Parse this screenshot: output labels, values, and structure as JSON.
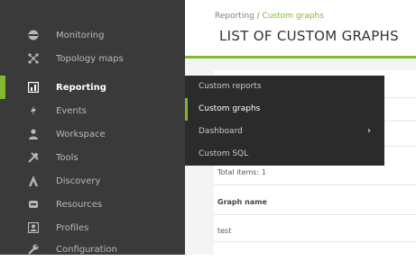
{
  "sidebar": {
    "items": [
      {
        "label": "Monitoring"
      },
      {
        "label": "Topology maps"
      },
      {
        "label": "Reporting"
      },
      {
        "label": "Events"
      },
      {
        "label": "Workspace"
      },
      {
        "label": "Tools"
      },
      {
        "label": "Discovery"
      },
      {
        "label": "Resources"
      },
      {
        "label": "Profiles"
      },
      {
        "label": "Configuration"
      }
    ]
  },
  "header": {
    "breadcrumb_parent": "Reporting",
    "breadcrumb_sep": " / ",
    "breadcrumb_current": "Custom graphs",
    "title": "LIST OF CUSTOM GRAPHS"
  },
  "submenu": {
    "items": [
      {
        "label": "Custom reports"
      },
      {
        "label": "Custom graphs"
      },
      {
        "label": "Dashboard"
      },
      {
        "label": "Custom SQL"
      }
    ],
    "arrow": "›"
  },
  "table": {
    "totals": "Total items: 1",
    "column": "Graph name",
    "rows": [
      {
        "name": "test"
      }
    ]
  },
  "colors": {
    "accent": "#82b92e",
    "sidebar_bg": "#3a3a3a",
    "submenu_bg": "#2b2b2b"
  }
}
